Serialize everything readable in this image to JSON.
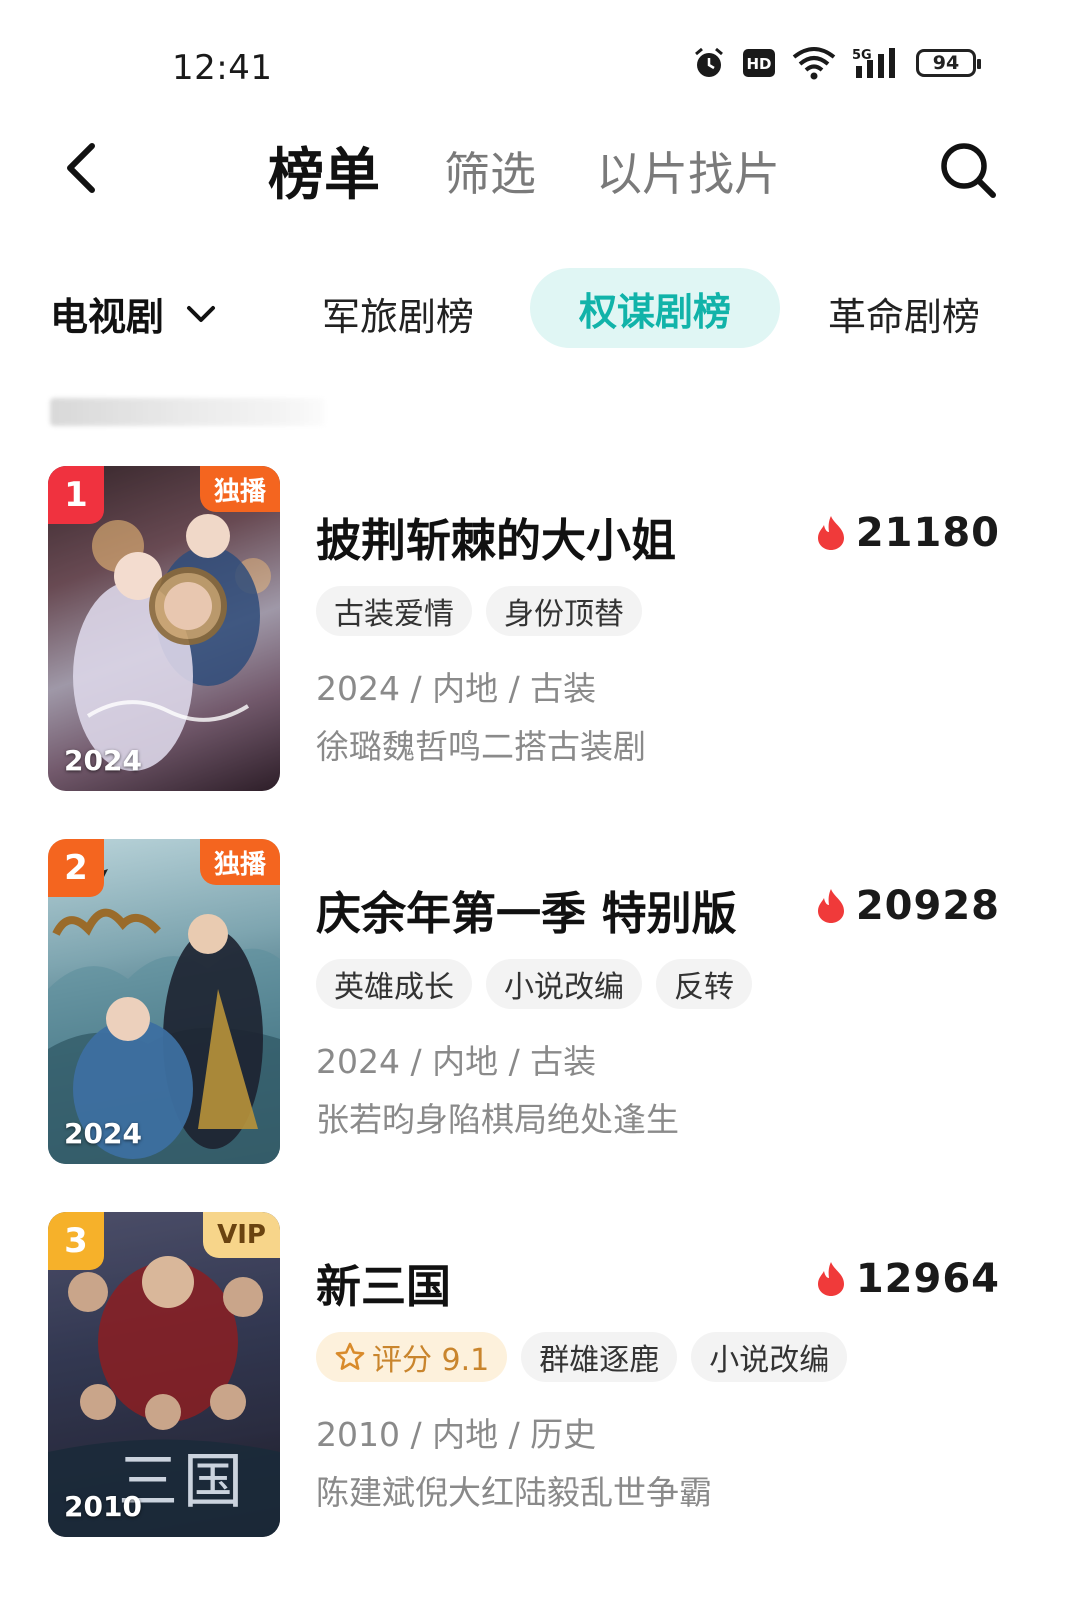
{
  "status_bar": {
    "time": "12:41",
    "battery": "94"
  },
  "header": {
    "title": "榜单",
    "tabs": [
      "筛选",
      "以片找片"
    ]
  },
  "category": {
    "dropdown": "电视剧",
    "tabs": [
      {
        "label": "军旅剧榜",
        "active": false
      },
      {
        "label": "权谋剧榜",
        "active": true
      },
      {
        "label": "革命剧榜",
        "active": false
      }
    ]
  },
  "items": [
    {
      "rank": "1",
      "badge": "独播",
      "poster_year": "2024",
      "title": "披荆斩棘的大小姐",
      "heat": "21180",
      "tags": [
        "古装爱情",
        "身份顶替"
      ],
      "meta": "2024 / 内地 / 古装",
      "desc": "徐璐魏哲鸣二搭古装剧"
    },
    {
      "rank": "2",
      "badge": "独播",
      "poster_year": "2024",
      "title": "庆余年第一季 特别版",
      "heat": "20928",
      "tags": [
        "英雄成长",
        "小说改编",
        "反转"
      ],
      "meta": "2024 / 内地 / 古装",
      "desc": "张若昀身陷棋局绝处逢生"
    },
    {
      "rank": "3",
      "badge": "VIP",
      "poster_year": "2010",
      "title": "新三国",
      "heat": "12964",
      "score_tag": "评分 9.1",
      "tags": [
        "群雄逐鹿",
        "小说改编"
      ],
      "meta": "2010 / 内地 / 历史",
      "desc": "陈建斌倪大红陆毅乱世争霸"
    }
  ],
  "colors": {
    "accent": "#11b3a9",
    "accent_bg": "#e0f6f4",
    "rank1": "#f0323f",
    "rank2": "#f4651f",
    "rank3": "#f6b12a",
    "badge_exclusive": "#f4651f",
    "badge_vip": "#f7d58a",
    "flame": "#f03a3a",
    "score_bg": "#fdf1dc",
    "score_text": "#c9852d"
  }
}
